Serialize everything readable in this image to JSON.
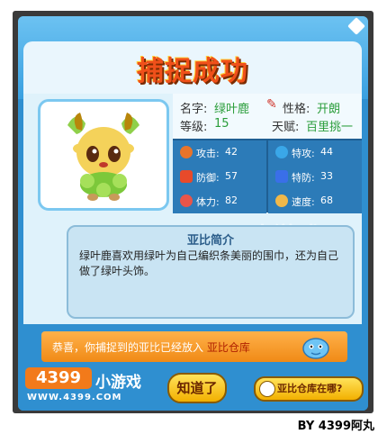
{
  "title": "捕捉成功",
  "pet": {
    "name_label": "名字:",
    "name_value": "绿叶鹿",
    "personality_label": "性格:",
    "personality_value": "开朗",
    "level_label": "等级:",
    "level_value": "15",
    "talent_label": "天赋:",
    "talent_value": "百里挑一"
  },
  "stats": [
    {
      "label": "攻击:",
      "value": "42",
      "color": "#e8742a"
    },
    {
      "label": "特攻:",
      "value": "44",
      "color": "#3aa7e8"
    },
    {
      "label": "防御:",
      "value": "57",
      "color": "#e84a2a"
    },
    {
      "label": "特防:",
      "value": "33",
      "color": "#3a6fe8"
    },
    {
      "label": "体力:",
      "value": "82",
      "color": "#e8554a"
    },
    {
      "label": "速度:",
      "value": "68",
      "color": "#f0b84a"
    }
  ],
  "intro": {
    "title": "亚比简介",
    "text": "绿叶鹿喜欢用绿叶为自己编织条美丽的围巾，还为自己做了绿叶头饰。"
  },
  "notice": {
    "prefix": "恭喜，你捕捉到的亚比已经放入",
    "highlight": "亚比仓库"
  },
  "footer": {
    "logo_text": "4399",
    "logo_sub": "小游戏",
    "logo_url": "WWW.4399.COM",
    "ok_label": "知道了",
    "warehouse_label": "亚比仓库在哪?"
  },
  "watermark": "4399小游戏",
  "credit": "BY 4399阿丸"
}
